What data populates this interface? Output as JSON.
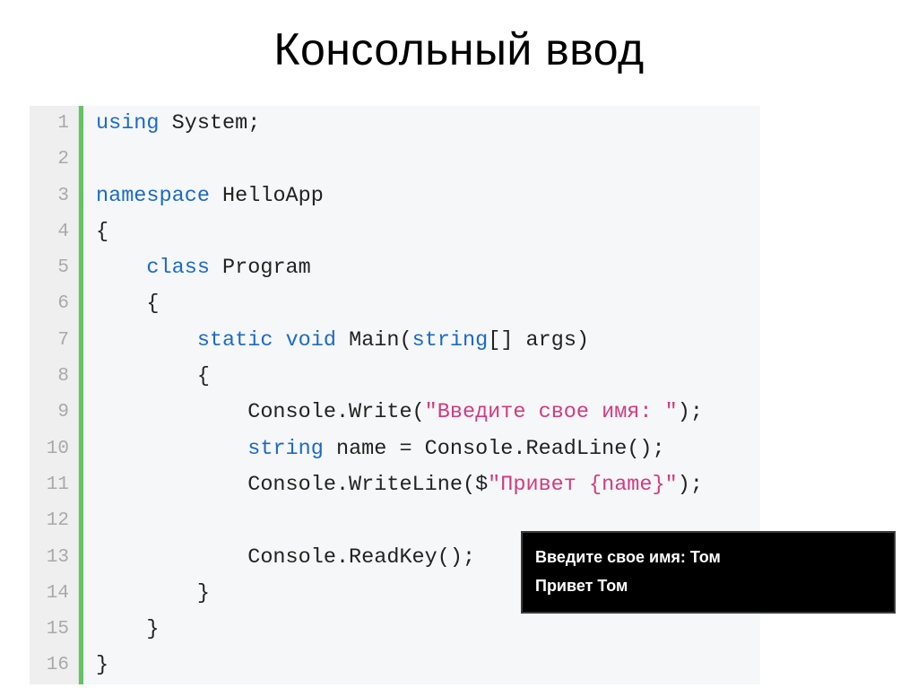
{
  "title": "Консольный ввод",
  "code": {
    "lines": [
      {
        "n": "1",
        "tokens": [
          {
            "c": "kw",
            "t": "using"
          },
          {
            "c": "pun",
            "t": " "
          },
          {
            "c": "cls",
            "t": "System"
          },
          {
            "c": "pun",
            "t": ";"
          }
        ]
      },
      {
        "n": "2",
        "tokens": []
      },
      {
        "n": "3",
        "tokens": [
          {
            "c": "kw",
            "t": "namespace"
          },
          {
            "c": "pun",
            "t": " "
          },
          {
            "c": "cls",
            "t": "HelloApp"
          }
        ]
      },
      {
        "n": "4",
        "tokens": [
          {
            "c": "pun",
            "t": "{"
          }
        ]
      },
      {
        "n": "5",
        "tokens": [
          {
            "c": "pun",
            "t": "    "
          },
          {
            "c": "kw",
            "t": "class"
          },
          {
            "c": "pun",
            "t": " "
          },
          {
            "c": "cls",
            "t": "Program"
          }
        ]
      },
      {
        "n": "6",
        "tokens": [
          {
            "c": "pun",
            "t": "    {"
          }
        ]
      },
      {
        "n": "7",
        "tokens": [
          {
            "c": "pun",
            "t": "        "
          },
          {
            "c": "kw",
            "t": "static"
          },
          {
            "c": "pun",
            "t": " "
          },
          {
            "c": "kw",
            "t": "void"
          },
          {
            "c": "pun",
            "t": " "
          },
          {
            "c": "cls",
            "t": "Main"
          },
          {
            "c": "pun",
            "t": "("
          },
          {
            "c": "kw",
            "t": "string"
          },
          {
            "c": "pun",
            "t": "[] args)"
          }
        ]
      },
      {
        "n": "8",
        "tokens": [
          {
            "c": "pun",
            "t": "        {"
          }
        ]
      },
      {
        "n": "9",
        "tokens": [
          {
            "c": "pun",
            "t": "            Console.Write("
          },
          {
            "c": "str",
            "t": "\"Введите свое имя: \""
          },
          {
            "c": "pun",
            "t": ");"
          }
        ]
      },
      {
        "n": "10",
        "tokens": [
          {
            "c": "pun",
            "t": "            "
          },
          {
            "c": "kw",
            "t": "string"
          },
          {
            "c": "pun",
            "t": " name = Console.ReadLine();"
          }
        ]
      },
      {
        "n": "11",
        "tokens": [
          {
            "c": "pun",
            "t": "            Console.WriteLine($"
          },
          {
            "c": "str",
            "t": "\"Привет {name}\""
          },
          {
            "c": "pun",
            "t": ");"
          }
        ]
      },
      {
        "n": "12",
        "tokens": []
      },
      {
        "n": "13",
        "tokens": [
          {
            "c": "pun",
            "t": "            Console.ReadKey();"
          }
        ]
      },
      {
        "n": "14",
        "tokens": [
          {
            "c": "pun",
            "t": "        }"
          }
        ]
      },
      {
        "n": "15",
        "tokens": [
          {
            "c": "pun",
            "t": "    }"
          }
        ]
      },
      {
        "n": "16",
        "tokens": [
          {
            "c": "pun",
            "t": "}"
          }
        ]
      }
    ]
  },
  "console": {
    "line1": "Введите свое имя: Том",
    "line2": "Привет Том"
  }
}
